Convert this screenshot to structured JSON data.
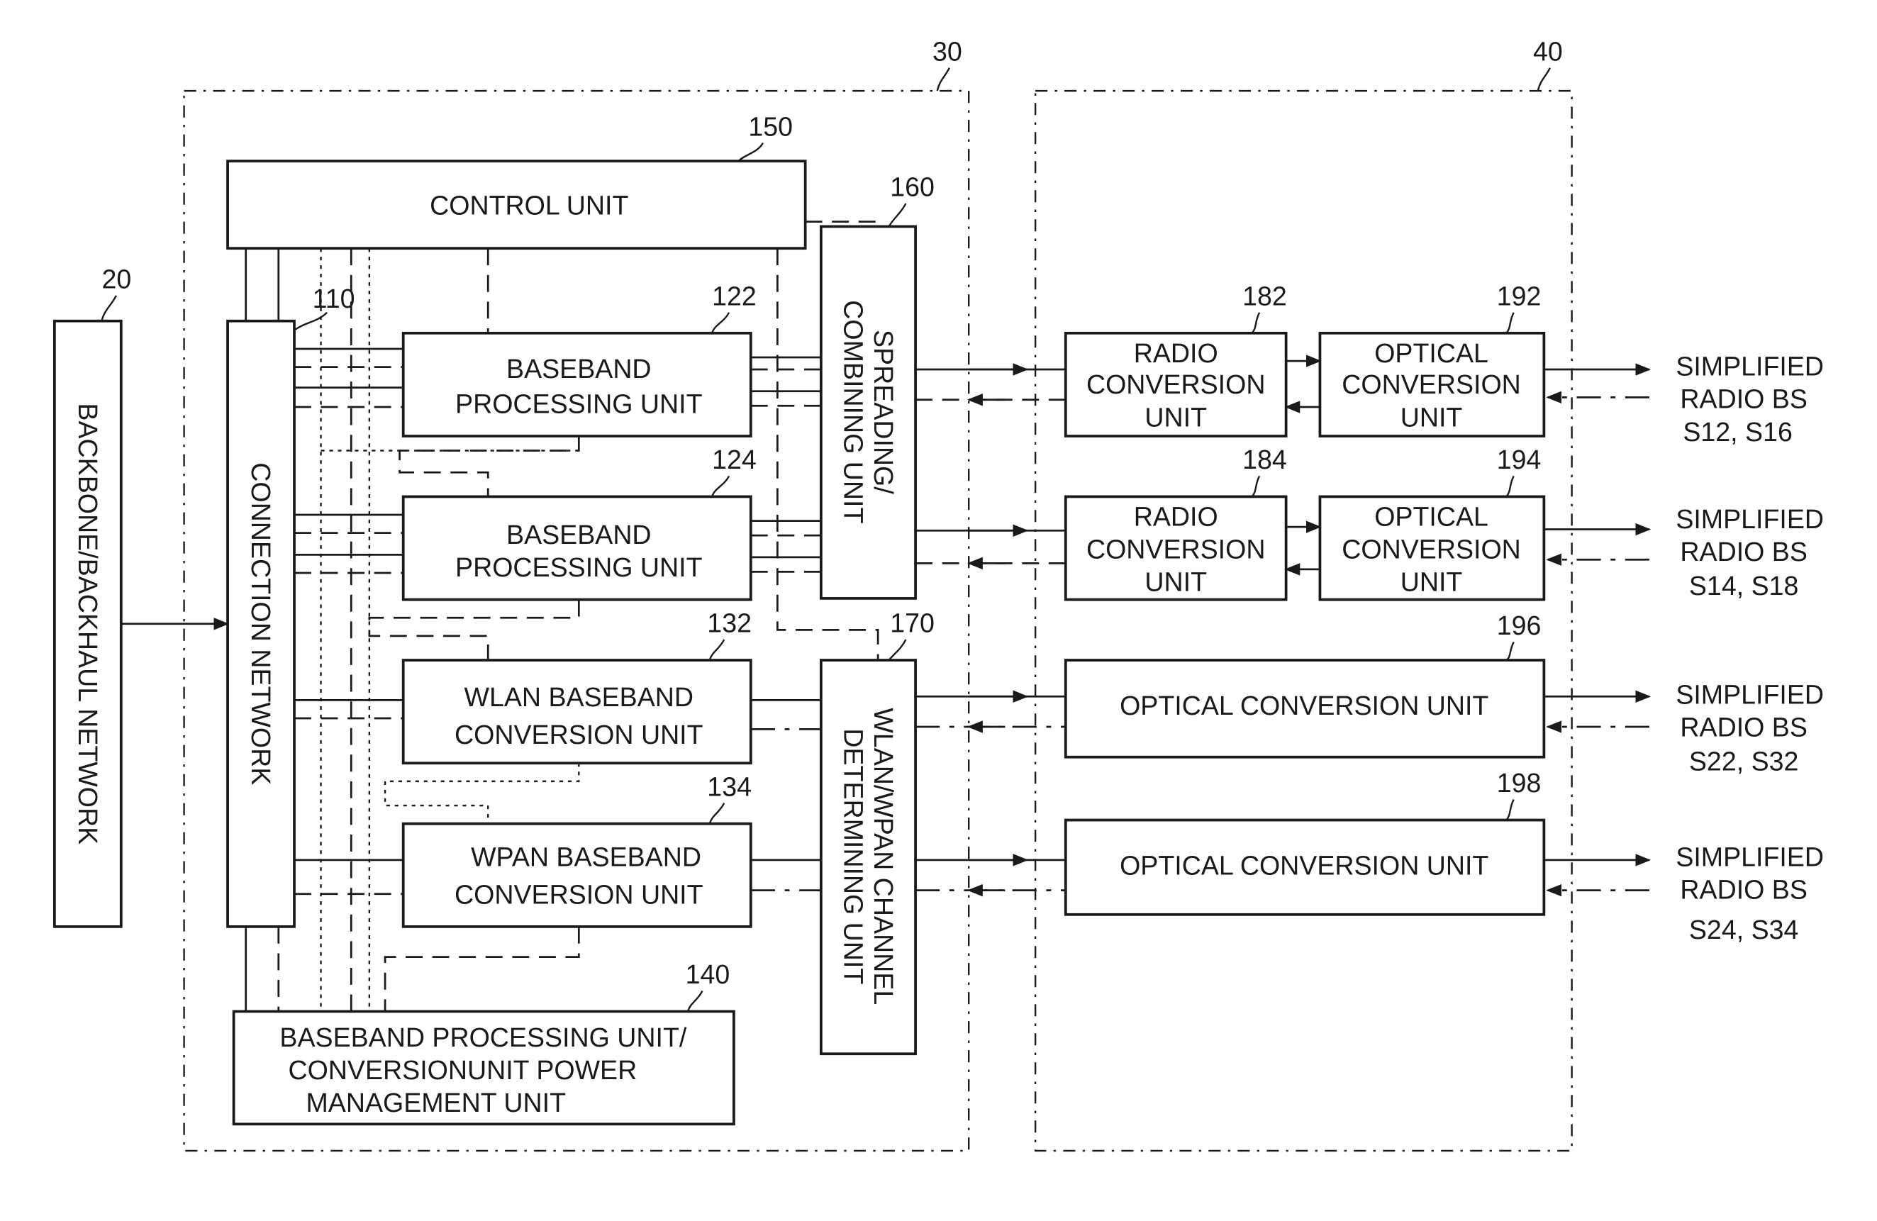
{
  "diagram": {
    "regions": [
      {
        "ref": "30"
      },
      {
        "ref": "40"
      }
    ],
    "backbone": {
      "ref": "20",
      "label": "BACKBONE/BACKHAUL NETWORK"
    },
    "connection_network": {
      "ref": "110",
      "label": "CONNECTION NETWORK"
    },
    "control_unit": {
      "ref": "150",
      "label": "CONTROL UNIT"
    },
    "spreading_unit": {
      "ref": "160",
      "label_line1": "SPREADING/",
      "label_line2": "COMBINING UNIT"
    },
    "channel_unit": {
      "ref": "170",
      "label_line1": "WLAN/WPAN CHANNEL",
      "label_line2": "DETERMINING UNIT"
    },
    "baseband_units": [
      {
        "ref": "122",
        "line1": "BASEBAND",
        "line2": "PROCESSING UNIT"
      },
      {
        "ref": "124",
        "line1": "BASEBAND",
        "line2": "PROCESSING UNIT"
      }
    ],
    "conversion_units": [
      {
        "ref": "132",
        "line1": "WLAN BASEBAND",
        "line2": "CONVERSION UNIT"
      },
      {
        "ref": "134",
        "line1": "WPAN BASEBAND",
        "line2": "CONVERSION UNIT"
      }
    ],
    "power_unit": {
      "ref": "140",
      "line1": "BASEBAND PROCESSING UNIT/",
      "line2": "CONVERSIONUNIT POWER",
      "line3": "MANAGEMENT UNIT"
    },
    "radio_units": [
      {
        "ref": "182",
        "line1": "RADIO",
        "line2": "CONVERSION",
        "line3": "UNIT"
      },
      {
        "ref": "184",
        "line1": "RADIO",
        "line2": "CONVERSION",
        "line3": "UNIT"
      }
    ],
    "optical_units_small": [
      {
        "ref": "192",
        "line1": "OPTICAL",
        "line2": "CONVERSION",
        "line3": "UNIT"
      },
      {
        "ref": "194",
        "line1": "OPTICAL",
        "line2": "CONVERSION",
        "line3": "UNIT"
      }
    ],
    "optical_units_wide": [
      {
        "ref": "196",
        "label": "OPTICAL CONVERSION UNIT"
      },
      {
        "ref": "198",
        "label": "OPTICAL CONVERSION UNIT"
      }
    ],
    "outputs": [
      {
        "line1": "SIMPLIFIED",
        "line2": "RADIO BS",
        "line3": "S12, S16"
      },
      {
        "line1": "SIMPLIFIED",
        "line2": "RADIO BS",
        "line3": "S14, S18"
      },
      {
        "line1": "SIMPLIFIED",
        "line2": "RADIO BS",
        "line3": "S22, S32"
      },
      {
        "line1": "SIMPLIFIED",
        "line2": "RADIO BS",
        "line3": "S24, S34"
      }
    ]
  }
}
